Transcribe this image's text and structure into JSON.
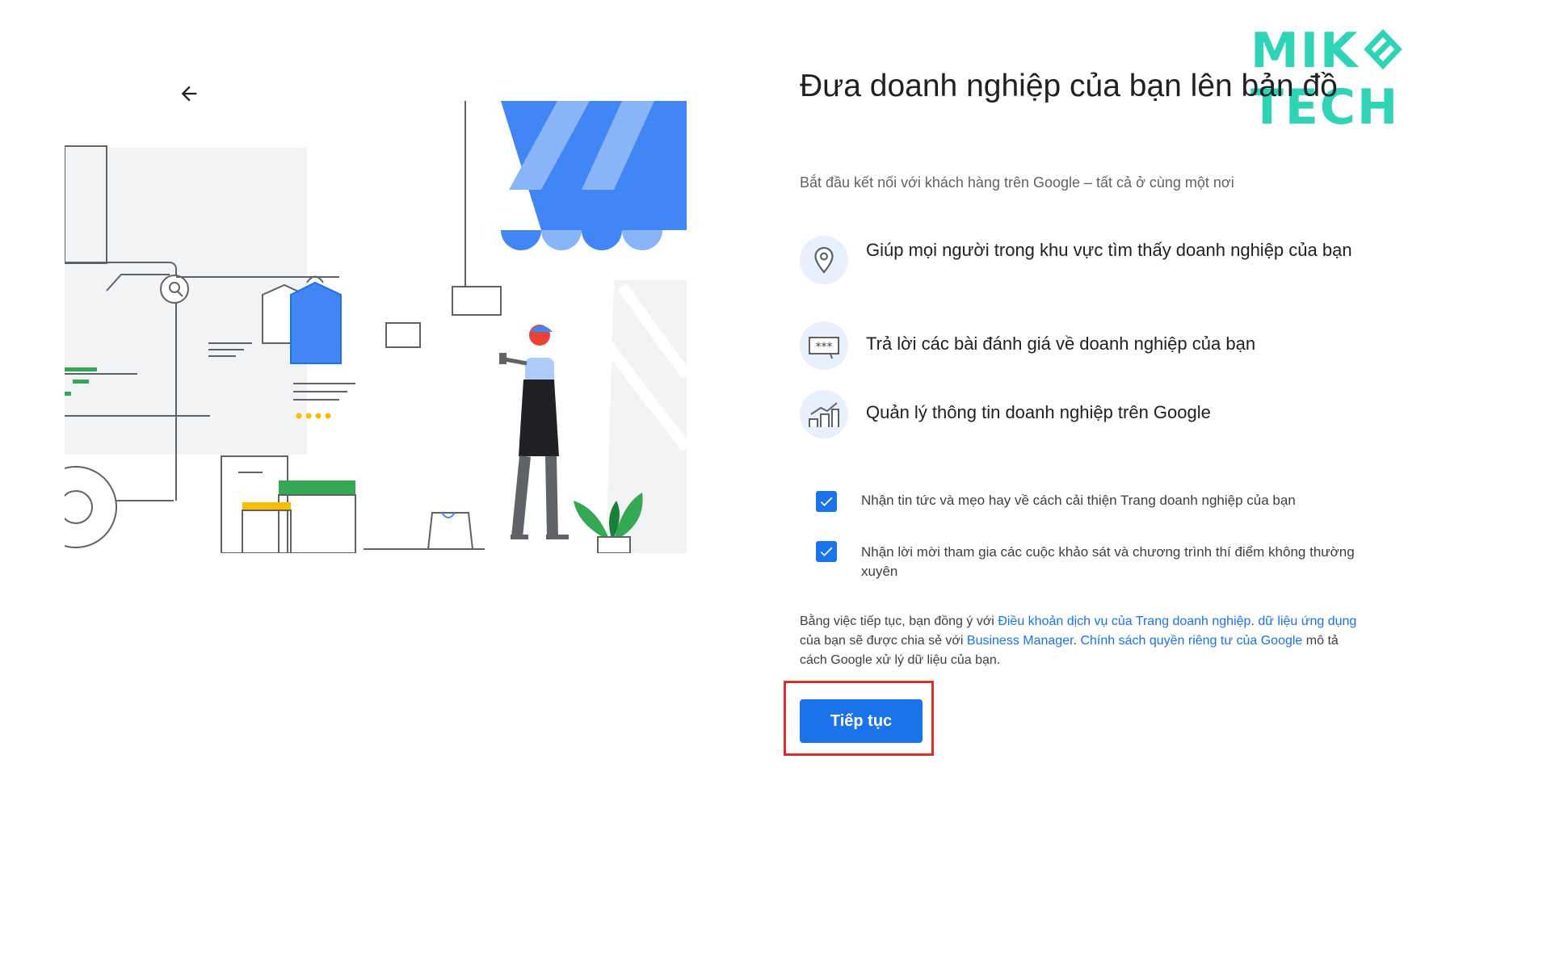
{
  "brand": {
    "logo_left": "MIK",
    "logo_right": "TECH",
    "color": "#2fd3b6"
  },
  "nav": {
    "back_icon": "arrow-left-icon"
  },
  "header": {
    "title": "Đưa doanh nghiệp của bạn lên bản đồ",
    "subtitle": "Bắt đầu kết nối với khách hàng trên Google – tất cả ở cùng một nơi"
  },
  "features": [
    {
      "icon": "location-pin-icon",
      "text": "Giúp mọi người trong khu vực tìm thấy doanh nghiệp của bạn"
    },
    {
      "icon": "review-stars-icon",
      "text": "Trả lời các bài đánh giá về doanh nghiệp của bạn"
    },
    {
      "icon": "growth-chart-icon",
      "text": "Quản lý thông tin doanh nghiệp trên Google"
    }
  ],
  "checkboxes": [
    {
      "label": "Nhận tin tức và mẹo hay về cách cải thiện Trang doanh nghiệp của bạn",
      "checked": true
    },
    {
      "label": "Nhận lời mời tham gia các cuộc khảo sát và chương trình thí điểm không thường xuyên",
      "checked": true
    }
  ],
  "legal": {
    "p1": "Bằng việc tiếp tục, bạn đồng ý với ",
    "link1": "Điều khoản dịch vụ của Trang doanh nghiệp",
    "p2": ". ",
    "link2": "dữ liệu ứng dụng",
    "p3": " của bạn sẽ được chia sẻ với ",
    "link3": "Business Manager",
    "p4": ". ",
    "link4": "Chính sách quyền riêng tư của Google",
    "p5": " mô tả cách Google xử lý dữ liệu của bạn."
  },
  "cta": {
    "label": "Tiếp tục"
  },
  "colors": {
    "accent": "#1a73e8",
    "highlight": "#d93025",
    "awning": "#4285f4"
  }
}
